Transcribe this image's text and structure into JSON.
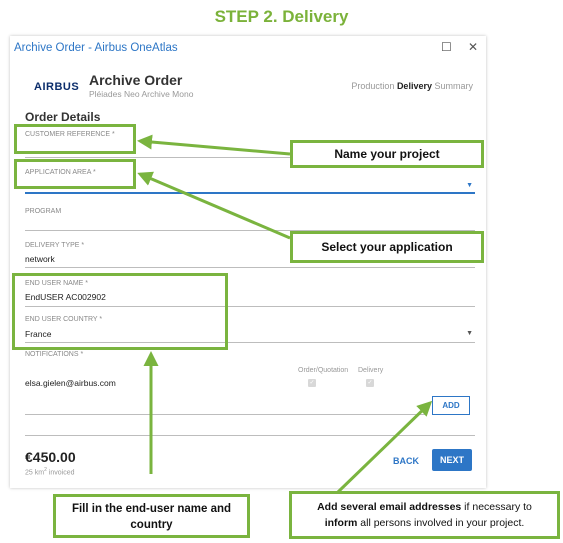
{
  "step_title": "STEP 2. Delivery",
  "window": {
    "title": "Archive Order - Airbus OneAtlas",
    "maximize_icon": "☐",
    "close_icon": "✕"
  },
  "header": {
    "brand": "AIRBUS",
    "title": "Archive Order",
    "subtitle": "Pléiades Neo Archive Mono",
    "steps": {
      "production": "Production",
      "delivery": "Delivery",
      "summary": "Summary",
      "active": "Delivery"
    }
  },
  "form": {
    "section_title": "Order Details",
    "customer_reference": {
      "label": "CUSTOMER REFERENCE *",
      "value": ""
    },
    "application_area": {
      "label": "APPLICATION AREA *",
      "value": ""
    },
    "program": {
      "label": "PROGRAM",
      "value": ""
    },
    "delivery_type": {
      "label": "DELIVERY TYPE *",
      "value": "network"
    },
    "end_user_name": {
      "label": "END USER NAME *",
      "value": "EndUSER AC002902"
    },
    "end_user_country": {
      "label": "END USER COUNTRY *",
      "value": "France"
    },
    "notifications": {
      "label": "NOTIFICATIONS *",
      "email": "elsa.gielen@airbus.com",
      "col_order": "Order/Quotation",
      "col_delivery": "Delivery",
      "order_checked": true,
      "delivery_checked": true
    },
    "add_label": "ADD"
  },
  "footer": {
    "price": "€450.00",
    "area_value": "25",
    "area_unit": "km",
    "area_exp": "2",
    "area_suffix": "invoiced",
    "back_label": "BACK",
    "next_label": "NEXT"
  },
  "callouts": {
    "name_project": "Name your project",
    "select_application": "Select your application",
    "fill_end_user": "Fill in the end-user name and country",
    "add_emails_bold1": "Add several email addresses",
    "add_emails_light1": " if necessary to",
    "add_emails_bold2": "inform",
    "add_emails_light2": " all persons involved in your project."
  },
  "colors": {
    "accent_green": "#7ab43f",
    "link_blue": "#2d76c6",
    "brand_navy": "#0b2d6b"
  }
}
